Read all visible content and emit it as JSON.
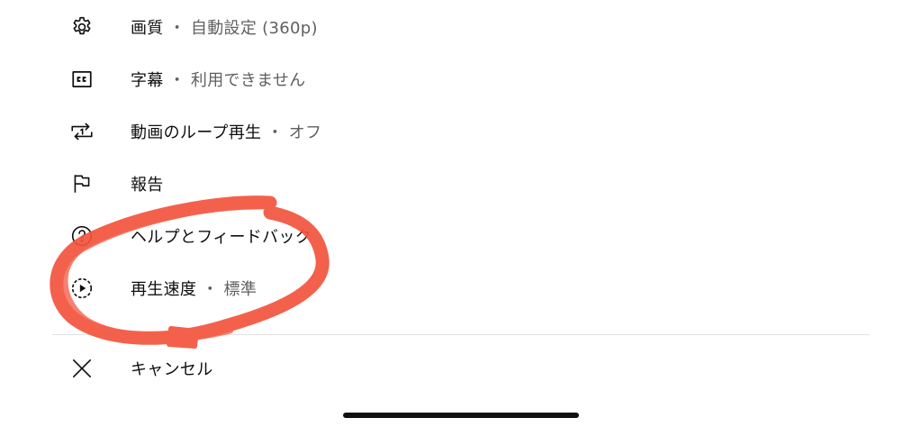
{
  "menu": {
    "quality": {
      "label": "画質",
      "value": "自動設定 (360p)",
      "icon": "gear-icon"
    },
    "captions": {
      "label": "字幕",
      "value": "利用できません",
      "icon": "closed-captions-icon"
    },
    "loop": {
      "label": "動画のループ再生",
      "value": "オフ",
      "icon": "loop-icon"
    },
    "report": {
      "label": "報告",
      "icon": "flag-icon"
    },
    "help": {
      "label": "ヘルプとフィードバック",
      "icon": "help-circle-icon"
    },
    "speed": {
      "label": "再生速度",
      "value": "標準",
      "icon": "playback-speed-icon"
    },
    "cancel": {
      "label": "キャンセル",
      "icon": "close-icon"
    },
    "separator": "・"
  },
  "annotation": {
    "color": "#f2543d",
    "shape": "freehand-circle"
  }
}
